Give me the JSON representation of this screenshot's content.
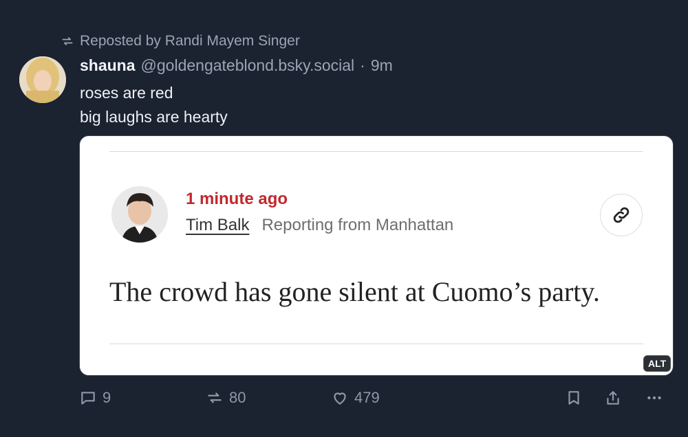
{
  "repost": {
    "label": "Reposted by Randi Mayem Singer"
  },
  "post": {
    "display_name": "shauna",
    "handle": "@goldengateblond.bsky.social",
    "separator": "·",
    "time": "9m",
    "lines": [
      "roses are red",
      "big laughs are hearty"
    ]
  },
  "embed": {
    "time_ago": "1 minute ago",
    "author": "Tim Balk",
    "location": "Reporting from Manhattan",
    "headline": "The crowd has gone silent at Cuomo’s party.",
    "alt_badge": "ALT"
  },
  "actions": {
    "reply_count": "9",
    "repost_count": "80",
    "like_count": "479"
  },
  "icons": [
    "repost-icon",
    "reply-icon",
    "like-icon",
    "bookmark-icon",
    "share-icon",
    "more-icon",
    "link-icon"
  ],
  "colors": {
    "background": "#1b2230",
    "accent_red": "#c0282d",
    "muted": "#9aa6b5"
  }
}
